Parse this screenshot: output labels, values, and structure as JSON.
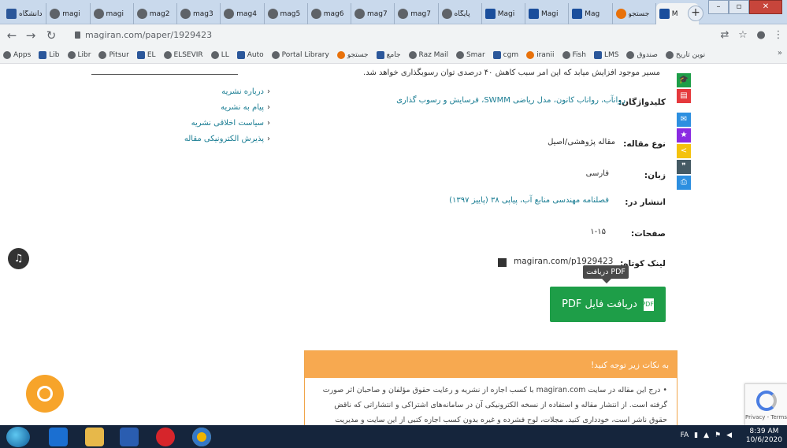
{
  "browser": {
    "tabs": [
      {
        "title": "دانشگاه",
        "icon": "site-icon"
      },
      {
        "title": "magi",
        "icon": "globe-icon"
      },
      {
        "title": "magi",
        "icon": "globe-icon"
      },
      {
        "title": "mag2",
        "icon": "globe-icon"
      },
      {
        "title": "mag3",
        "icon": "globe-icon"
      },
      {
        "title": "mag4",
        "icon": "globe-icon"
      },
      {
        "title": "mag5",
        "icon": "globe-icon"
      },
      {
        "title": "mag6",
        "icon": "globe-icon"
      },
      {
        "title": "mag7",
        "icon": "globe-icon"
      },
      {
        "title": "mag7",
        "icon": "globe-icon"
      },
      {
        "title": "پایگاه",
        "icon": "globe-icon"
      },
      {
        "title": "Magi",
        "icon": "doc-icon"
      },
      {
        "title": "Magi",
        "icon": "doc-icon"
      },
      {
        "title": "Mag",
        "icon": "doc-icon"
      },
      {
        "title": "جستجو",
        "icon": "google-icon"
      },
      {
        "title": "M",
        "icon": "doc-icon",
        "active": true
      }
    ],
    "new_tab": "+",
    "url": "magiran.com/paper/1929423",
    "bookmarks": [
      {
        "label": "Apps"
      },
      {
        "label": "Lib"
      },
      {
        "label": "Libr"
      },
      {
        "label": "Pitsur"
      },
      {
        "label": "EL"
      },
      {
        "label": "ELSEVIR"
      },
      {
        "label": "LL"
      },
      {
        "label": "Auto"
      },
      {
        "label": "Portal Library"
      },
      {
        "label": "جستجو"
      },
      {
        "label": "جامع"
      },
      {
        "label": "Raz Mail"
      },
      {
        "label": "Smar"
      },
      {
        "label": "cgm"
      },
      {
        "label": "iranii"
      },
      {
        "label": "Fish"
      },
      {
        "label": "LMS"
      },
      {
        "label": "صندوق"
      },
      {
        "label": "نوين تاريخ"
      }
    ],
    "bookmarks_more": "»"
  },
  "page": {
    "abstract_tail": "مسیر موجود افزایش میابد که این امر سبب کاهش ۴۰ درصدی توان رسوبگذاری خواهد شد.",
    "sidebar_links": [
      "درباره نشریه",
      "پیام به نشریه",
      "سیاست اخلاقی نشریه",
      "پذیرش الکترونیکی مقاله"
    ],
    "meta": {
      "keywords_label": "کلیدواژگان:",
      "keywords_value": "روانآب، رواناب کانون، مدل ریاضی SWMM، فرسایش و رسوب گذاری",
      "type_label": "نوع مقاله:",
      "type_value": "مقاله پژوهشی/اصیل",
      "language_label": "زبان:",
      "language_value": "فارسی",
      "published_label": "انتشار در:",
      "published_value": "فصلنامه مهندسی منابع آب، پیاپی ۳۸ (پاییز ۱۳۹۷)",
      "pages_label": "صفحات:",
      "pages_value": "۱-۱۵",
      "shortlink_label": "لینک کوتاه:",
      "shortlink_value": "magiran.com/p1929423"
    },
    "share_buttons": [
      {
        "icon": "graduation-cap-icon",
        "color": "#1e9e48"
      },
      {
        "icon": "pdf-file-icon",
        "color": "#e5393d"
      },
      {
        "icon": "mail-icon",
        "color": "#2d8fe0"
      },
      {
        "icon": "star-icon",
        "color": "#8a2be2"
      },
      {
        "icon": "share-icon",
        "color": "#f4c20d"
      },
      {
        "icon": "quote-icon",
        "color": "#455a64"
      },
      {
        "icon": "print-icon",
        "color": "#2d8fe0"
      }
    ],
    "pdf_tooltip": "دریافت PDF",
    "pdf_button": "دریافت فایل PDF",
    "notice_title": "به نکات زیر توجه کنید!",
    "notice_body": "• درج این مقاله در سایت magiran.com با کسب اجازه از نشریه و رعایت حقوق مؤلفان و صاحبان اثر صورت گرفته است. از انتشار مقاله و استفاده از نسخه الکترونیکی آن در سامانه‌های اشتراکی و انتشاراتی که ناقض حقوق ناشر است، خودداری کنید. مجلات، لوح فشرده و غیره بدون کسب اجازه کتبی از این سایت و مدیریت نشریه، ممنوع است. با رعایت شرایط مورد نظر ناشر ممنوع"
  },
  "widgets": {
    "recaptcha_text": "Privacy - Terms"
  },
  "taskbar": {
    "apps": [
      {
        "name": "start-button"
      },
      {
        "name": "internet-explorer-icon"
      },
      {
        "name": "file-explorer-icon"
      },
      {
        "name": "media-player-icon"
      },
      {
        "name": "opera-icon"
      },
      {
        "name": "chrome-icon"
      }
    ],
    "tray_language": "FA",
    "time": "8:39 AM",
    "date": "10/6/2020"
  }
}
